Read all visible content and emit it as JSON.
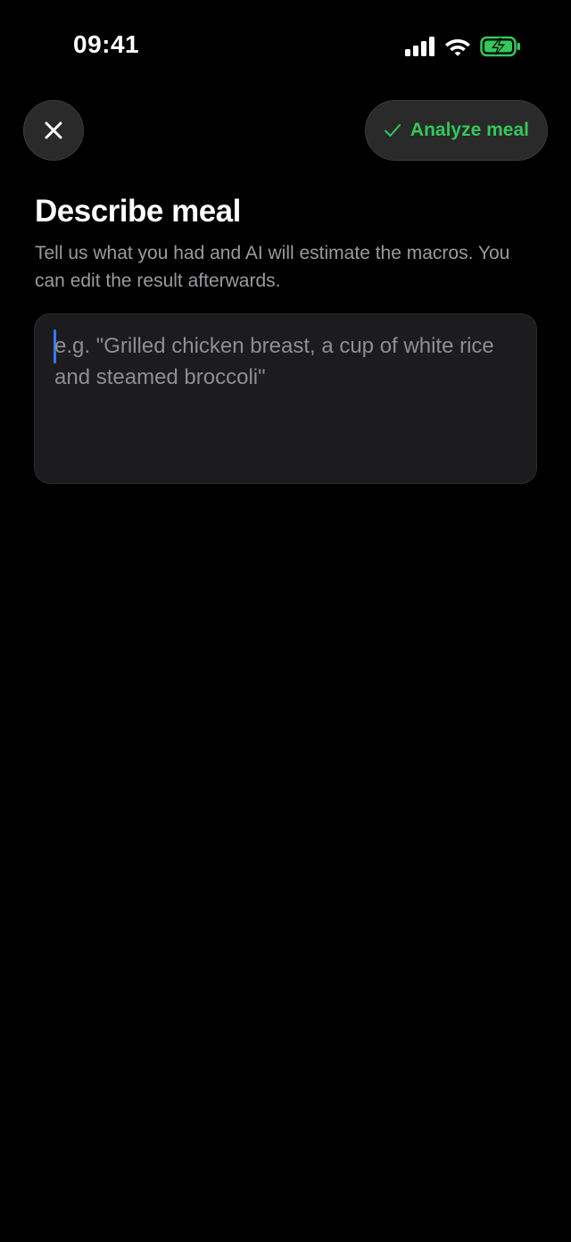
{
  "status_bar": {
    "time": "09:41",
    "icons": [
      "cellular-signal-icon",
      "wifi-icon",
      "battery-charging-icon"
    ],
    "battery_color": "#34c759"
  },
  "toolbar": {
    "close_icon": "close-icon",
    "analyze_icon": "checkmark-icon",
    "analyze_label": "Analyze meal",
    "accent_color": "#34c759"
  },
  "page": {
    "title": "Describe meal",
    "subtitle": "Tell us what you had and AI will estimate the macros. You can edit the result afterwards."
  },
  "meal_input": {
    "value": "",
    "placeholder": "e.g. \"Grilled chicken breast, a cup of white rice and steamed broccoli\"",
    "cursor_color": "#3478f6"
  }
}
